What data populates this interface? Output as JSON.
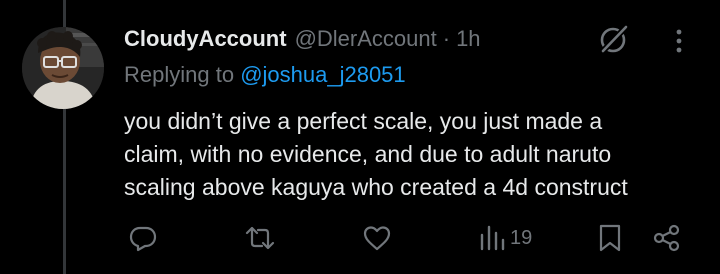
{
  "tweet": {
    "display_name": "CloudyAccount",
    "handle": "@DlerAccount",
    "separator": "·",
    "time": "1h",
    "replying_prefix": "Replying to ",
    "replying_to": "@joshua_j28051",
    "text_lines": [
      "you didn’t give a perfect scale, you just made a",
      "claim, with no evidence, and due to adult naruto",
      "scaling above kaguya who created a 4d construct"
    ]
  },
  "actions": {
    "reply_icon": "reply-icon",
    "retweet_icon": "retweet-icon",
    "like_icon": "like-icon",
    "views_icon": "views-icon",
    "views_count": "19",
    "bookmark_icon": "bookmark-icon",
    "share_icon": "share-icon"
  },
  "header_icons": {
    "grok": "grok-icon",
    "more": "more-icon"
  },
  "colors": {
    "background": "#000000",
    "text_primary": "#e7e9ea",
    "text_secondary": "#71767b",
    "accent": "#1d9bf0",
    "thread_line": "#333639"
  }
}
